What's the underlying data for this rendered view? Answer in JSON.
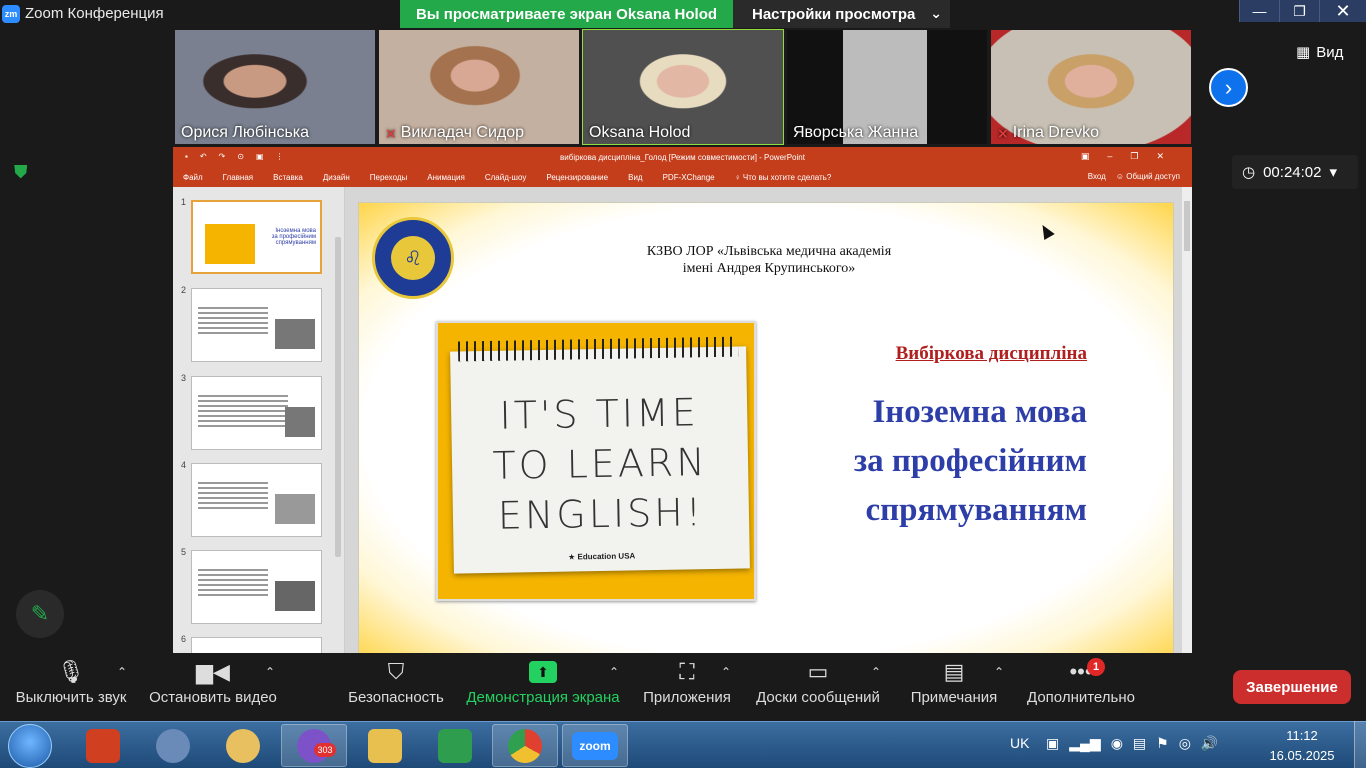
{
  "titlebar": {
    "app_title": "Zoom Конференция",
    "share_banner": "Вы просматриваете экран Oksana Holod",
    "view_options": "Настройки просмотра"
  },
  "participants": [
    {
      "name": "Орися Любінська",
      "muted": false
    },
    {
      "name": "Викладач Сидор",
      "muted": true
    },
    {
      "name": "Oksana Holod",
      "muted": false
    },
    {
      "name": "Яворська Жанна",
      "muted": false
    },
    {
      "name": "Irina Drevko",
      "muted": true
    }
  ],
  "view_button": "Вид",
  "timer": "00:24:02",
  "powerpoint": {
    "doc_title": "вибіркова дисципліна_Голод [Режим совместимости] - PowerPoint",
    "menu": [
      "Файл",
      "Главная",
      "Вставка",
      "Дизайн",
      "Переходы",
      "Анимация",
      "Слайд-шоу",
      "Рецензирование",
      "Вид",
      "PDF-XChange",
      "Что вы хотите сделать?"
    ],
    "signin": "Вход",
    "share": "Общий доступ",
    "thumbnails": [
      "1",
      "2",
      "3",
      "4",
      "5",
      "6"
    ]
  },
  "slide": {
    "institution_line1": "КЗВО ЛОР «Львівська медична академія",
    "institution_line2": "імені Андрея Крупинського»",
    "seal_text": "ЛЬВІВСЬКА МЕДИЧНА АКАДЕМІЯ",
    "notepad_line1": "IT'S TIME",
    "notepad_line2": "TO LEARN",
    "notepad_line3": "ENGLISH!",
    "notepad_logo": "Education USA",
    "subject_label": "Вибіркова дисципліна",
    "subject_line1": "Іноземна мова",
    "subject_line2": "за професійним",
    "subject_line3": "спрямуванням"
  },
  "toolbar": {
    "mute": "Выключить звук",
    "video": "Остановить видео",
    "security": "Безопасность",
    "share_screen": "Демонстрация экрана",
    "apps": "Приложения",
    "whiteboards": "Доски сообщений",
    "notes": "Примечания",
    "more": "Дополнительно",
    "more_badge": "1",
    "end": "Завершение"
  },
  "taskbar": {
    "viber_badge": "303",
    "zoom_label": "zoom",
    "language": "UK",
    "time": "11:12",
    "date": "16.05.2025"
  },
  "colors": {
    "share_green": "#23a94a",
    "zoom_blue": "#0e72ed",
    "ppt_red": "#c43e1c",
    "end_red": "#cc2d2d"
  }
}
